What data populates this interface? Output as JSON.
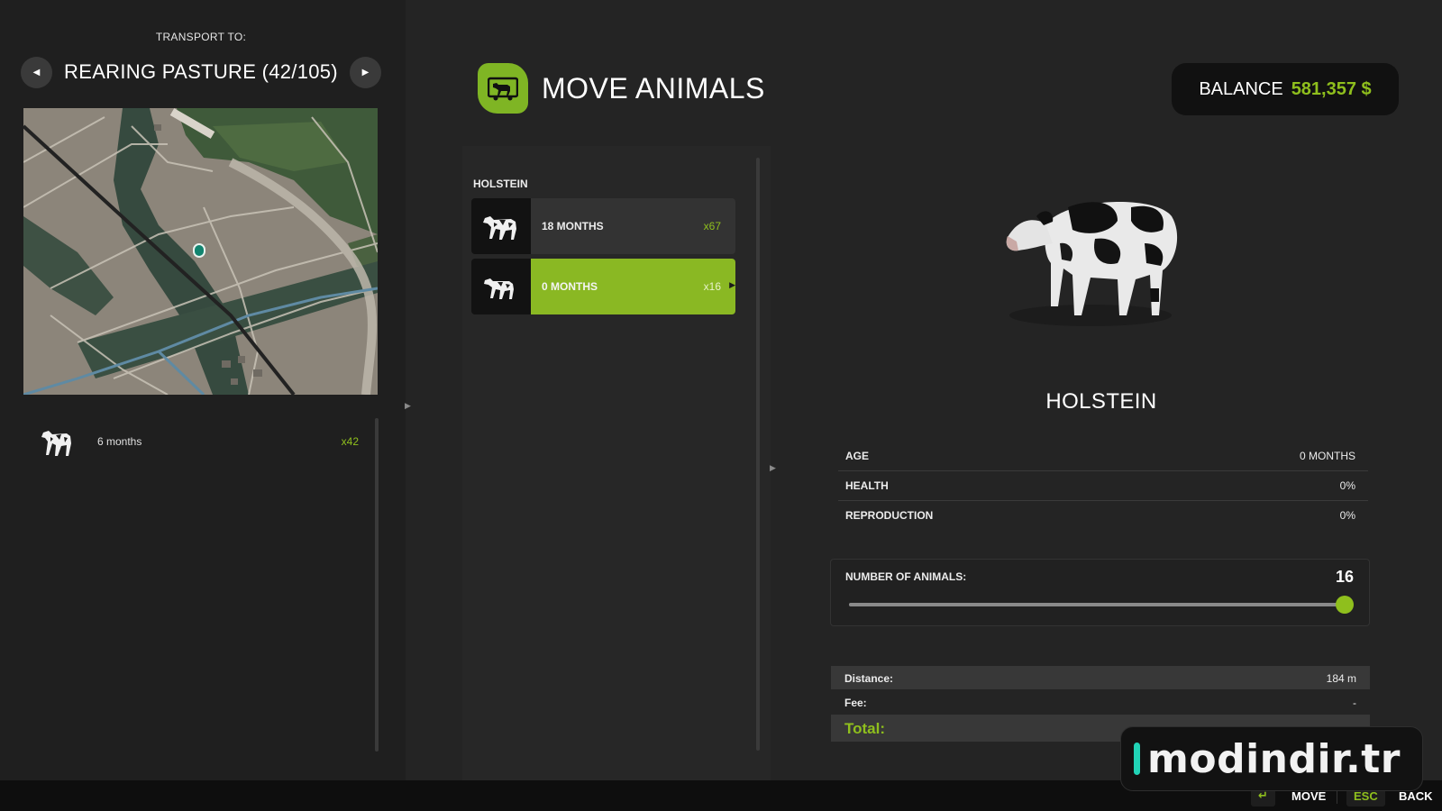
{
  "transport": {
    "label": "TRANSPORT TO:",
    "destination": "REARING PASTURE (42/105)",
    "prev_icon": "triangle-left",
    "next_icon": "triangle-right"
  },
  "map": {
    "marker_icon": "pasture-marker"
  },
  "destination_animals": [
    {
      "label": "6 months",
      "count": "x42",
      "icon": "cow-icon"
    }
  ],
  "header": {
    "title": "MOVE ANIMALS",
    "icon": "cow-trailer-icon",
    "balance_label": "BALANCE",
    "balance_value": "581,357 $"
  },
  "list": {
    "group": "HOLSTEIN",
    "items": [
      {
        "name": "18 MONTHS",
        "count": "x67",
        "selected": false
      },
      {
        "name": "0 MONTHS",
        "count": "x16",
        "selected": true
      }
    ]
  },
  "detail": {
    "name": "HOLSTEIN",
    "attributes": [
      {
        "key": "AGE",
        "value": "0 MONTHS"
      },
      {
        "key": "HEALTH",
        "value": "0%"
      },
      {
        "key": "REPRODUCTION",
        "value": "0%"
      }
    ],
    "number_label": "NUMBER OF ANIMALS:",
    "number_value": "16",
    "slider": {
      "min": 1,
      "max": 16,
      "value": 16
    }
  },
  "costs": {
    "distance_label": "Distance:",
    "distance_value": "184 m",
    "fee_label": "Fee:",
    "fee_value": "-",
    "total_label": "Total:",
    "total_value": "-"
  },
  "footer": {
    "move_key": "↵",
    "move_label": "MOVE",
    "back_key": "ESC",
    "back_label": "BACK"
  },
  "watermark": {
    "text": "modindir.tr"
  },
  "colors": {
    "accent": "#8fbf1d",
    "selected_bg": "#8ab823",
    "panel_bg": "#1f1f1f",
    "background": "#242424"
  }
}
